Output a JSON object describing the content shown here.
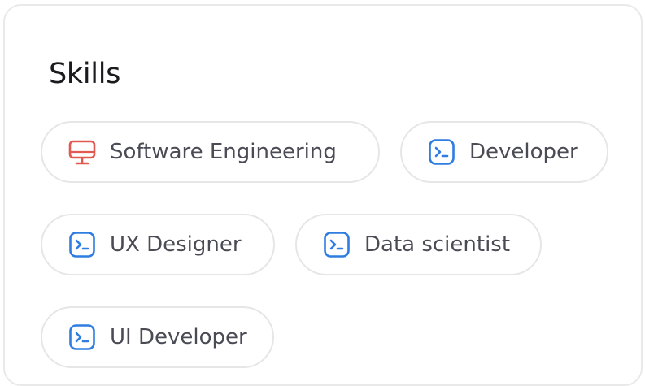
{
  "skills": {
    "title": "Skills",
    "colors": {
      "desktop_icon": "#e05a52",
      "terminal_icon": "#2f7de1",
      "chip_border": "#e6e6e6",
      "label": "#4b4b55"
    },
    "chips": [
      {
        "label": "Software Engineering",
        "icon": "desktop-icon"
      },
      {
        "label": "Developer",
        "icon": "terminal-icon"
      },
      {
        "label": "UX Designer",
        "icon": "terminal-icon"
      },
      {
        "label": "Data scientist",
        "icon": "terminal-icon"
      },
      {
        "label": "UI Developer",
        "icon": "terminal-icon"
      }
    ]
  }
}
